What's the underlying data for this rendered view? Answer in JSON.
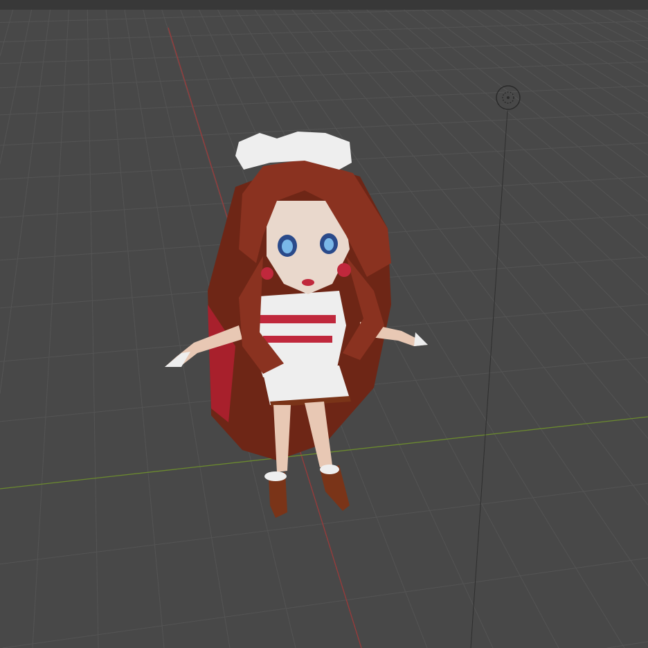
{
  "viewport": {
    "background": "#484848",
    "header_color": "#383838",
    "grid_color": "#545454",
    "x_axis_color": "#9a3a3a",
    "y_axis_color": "#6b8a2e"
  },
  "character": {
    "hair_color": "#7a2a18",
    "skin_color": "#e8c8b4",
    "outfit_white": "#eeeeee",
    "outfit_red": "#c0283c",
    "boot_color": "#7a3418"
  }
}
